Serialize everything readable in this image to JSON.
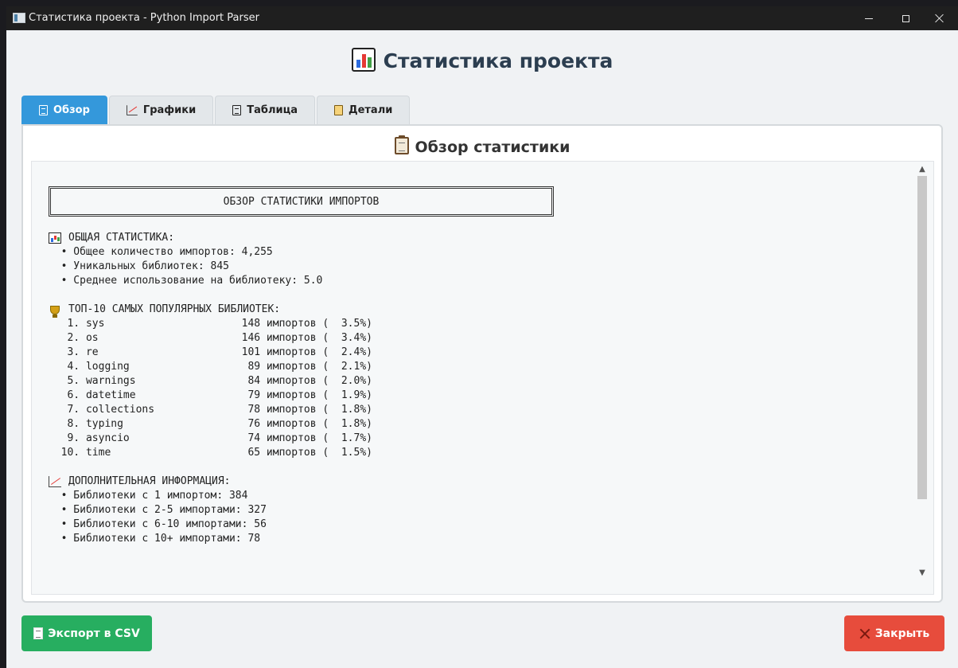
{
  "window": {
    "title": "Статистика проекта - Python Import Parser"
  },
  "header": {
    "icon": "bar-chart-icon",
    "title": "Статистика проекта"
  },
  "tabs": [
    {
      "label": "Обзор",
      "icon": "document-icon",
      "active": true
    },
    {
      "label": "Графики",
      "icon": "line-chart-icon",
      "active": false
    },
    {
      "label": "Таблица",
      "icon": "document-icon",
      "active": false
    },
    {
      "label": "Детали",
      "icon": "notepad-icon",
      "active": false
    }
  ],
  "overview": {
    "title": "Обзор статистики",
    "title_icon": "clipboard-icon",
    "box_title": "ОБЗОР СТАТИСТИКИ ИМПОРТОВ",
    "general": {
      "heading": "ОБЩАЯ СТАТИСТИКА:",
      "items": [
        "  • Общее количество импортов: 4,255",
        "  • Уникальных библиотек: 845",
        "  • Среднее использование на библиотеку: 5.0"
      ]
    },
    "top": {
      "heading": "ТОП-10 САМЫХ ПОПУЛЯРНЫХ БИБЛИОТЕК:",
      "items": [
        "   1. sys                      148 импортов (  3.5%)",
        "   2. os                       146 импортов (  3.4%)",
        "   3. re                       101 импортов (  2.4%)",
        "   4. logging                   89 импортов (  2.1%)",
        "   5. warnings                  84 импортов (  2.0%)",
        "   6. datetime                  79 импортов (  1.9%)",
        "   7. collections               78 импортов (  1.8%)",
        "   8. typing                    76 импортов (  1.8%)",
        "   9. asyncio                   74 импортов (  1.7%)",
        "  10. time                      65 импортов (  1.5%)"
      ]
    },
    "extra": {
      "heading": "ДОПОЛНИТЕЛЬНАЯ ИНФОРМАЦИЯ:",
      "items": [
        "  • Библиотеки с 1 импортом: 384",
        "  • Библиотеки с 2-5 импортами: 327",
        "  • Библиотеки с 6-10 импортами: 56",
        "  • Библиотеки с 10+ импортами: 78"
      ]
    }
  },
  "buttons": {
    "export": "Экспорт в CSV",
    "close": "Закрыть"
  },
  "colors": {
    "active_tab": "#3498db",
    "export_button": "#27ae60",
    "close_button": "#e74c3c",
    "header_text": "#2c3e50"
  }
}
